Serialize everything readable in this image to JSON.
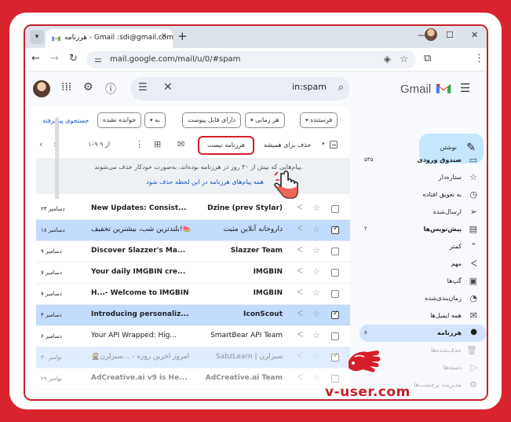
{
  "browser": {
    "tab_title": "هرزنامه - Gmail :sdi@gmail.com",
    "url": "mail.google.com/mail/u/0/#spam"
  },
  "gmail": {
    "logo_text": "Gmail",
    "search_query": "in:spam"
  },
  "filters": {
    "from": "فرستنده",
    "any_time": "هر زمانی",
    "has_attachment": "دارای فایل پیوست",
    "to": "به",
    "is_unread": "خوانده نشده",
    "advanced_search": "جستجوی پیشرفته"
  },
  "toolbar": {
    "delete_forever": "حذف برای همیشه",
    "not_spam": "هرزنامه نیست",
    "pager": "۱–۹ از ۹"
  },
  "banner": {
    "text": "پیام‌هایی که بیش از ۳۰ روز در هرزنامه بوده‌اند، به‌صورت خودکار حذف می‌شوند.",
    "link": "همه پیام‌های هرزنامه در این لحظه حذف شود"
  },
  "emails": [
    {
      "from": "Dzine (prev Stylar)",
      "subject": "New Updates: Consist...",
      "date": "۲۴ دسامبر",
      "selected": false,
      "read": false,
      "faded": false
    },
    {
      "from": "داروخانه آنلاین مثبت",
      "subject": "بلندترین شب، بیشترین تخفیف!🍉",
      "date": "۱۸ دسامبر",
      "selected": true,
      "read": true,
      "faded": false
    },
    {
      "from": "Slazzer Team",
      "subject": "Discover Slazzer's Ma...",
      "date": "۹ دسامبر",
      "selected": false,
      "read": false,
      "faded": false
    },
    {
      "from": "IMGBIN",
      "subject": "Your daily IMGBIN cre...",
      "date": "۷ دسامبر",
      "selected": false,
      "read": false,
      "faded": false
    },
    {
      "from": "IMGBIN",
      "subject": "H...- Welcome to IMGBIN",
      "date": "۷ دسامبر",
      "selected": false,
      "read": false,
      "faded": false
    },
    {
      "from": "IconScout",
      "subject": "Introducing personaliz...",
      "date": "۴ دسامبر",
      "selected": true,
      "read": false,
      "faded": false
    },
    {
      "from": "SmartBear API Team",
      "subject": "Your API Wrapped: Hig...",
      "date": "۶ دسامبر",
      "selected": false,
      "read": true,
      "faded": false
    },
    {
      "from": "SabzLearn | سبزلرن",
      "subject": "🥷امروز آخرین روزه - ...سبزلرن",
      "date": "۳۰ نوامبر",
      "selected": true,
      "read": true,
      "faded": true
    },
    {
      "from": "AdCreative.ai Team",
      "subject": "AdCreative.ai v9 is He...",
      "date": "۲۹ نوامبر",
      "selected": false,
      "read": false,
      "faded": true
    }
  ],
  "sidebar": {
    "compose": "نوشتن",
    "items": [
      {
        "label": "صندوق ورودی",
        "count": "۵۴۵",
        "icon": "inbox-icon",
        "glyph": "▭",
        "bold": true,
        "active": false,
        "faded": false
      },
      {
        "label": "ستاره‌دار",
        "count": "",
        "icon": "star-icon",
        "glyph": "☆",
        "bold": false,
        "active": false,
        "faded": false
      },
      {
        "label": "به تعویق افتاده",
        "count": "",
        "icon": "clock-icon",
        "glyph": "◷",
        "bold": false,
        "active": false,
        "faded": false
      },
      {
        "label": "ارسال‌شده",
        "count": "",
        "icon": "send-icon",
        "glyph": "➢",
        "bold": false,
        "active": false,
        "faded": false
      },
      {
        "label": "پیش‌نویس‌ها",
        "count": "۲",
        "icon": "draft-icon",
        "glyph": "▤",
        "bold": true,
        "active": false,
        "faded": false
      },
      {
        "label": "کمتر",
        "count": "",
        "icon": "chevron-up-icon",
        "glyph": "⌃",
        "bold": false,
        "active": false,
        "faded": false
      },
      {
        "label": "مهم",
        "count": "",
        "icon": "important-icon",
        "glyph": "ᐸ",
        "bold": false,
        "active": false,
        "faded": false
      },
      {
        "label": "گپ‌ها",
        "count": "",
        "icon": "chat-icon",
        "glyph": "▣",
        "bold": false,
        "active": false,
        "faded": false
      },
      {
        "label": "زمان‌بندی‌شده",
        "count": "",
        "icon": "scheduled-icon",
        "glyph": "◔",
        "bold": false,
        "active": false,
        "faded": false
      },
      {
        "label": "همه ایمیل‌ها",
        "count": "",
        "icon": "all-mail-icon",
        "glyph": "✉",
        "bold": false,
        "active": false,
        "faded": false
      },
      {
        "label": "هرزنامه",
        "count": "۸",
        "icon": "spam-icon",
        "glyph": "●",
        "bold": true,
        "active": true,
        "faded": false
      },
      {
        "label": "حذف‌شده‌ها",
        "count": "",
        "icon": "trash-icon",
        "glyph": "🗑",
        "bold": false,
        "active": false,
        "faded": true
      },
      {
        "label": "دسته‌ها",
        "count": "",
        "icon": "label-icon",
        "glyph": "▷",
        "bold": false,
        "active": false,
        "faded": true
      },
      {
        "label": "مدیریت برچسب‌ها",
        "count": "",
        "icon": "settings-icon",
        "glyph": "⚙",
        "bold": false,
        "active": false,
        "faded": true
      }
    ]
  },
  "watermark": {
    "text": "v-user.com"
  },
  "colors": {
    "accent_red": "#d51f2b",
    "selected_row": "#c2dbff",
    "compose_bg": "#c2e7ff",
    "active_nav": "#d3e3fd",
    "link_blue": "#1a56c4"
  }
}
